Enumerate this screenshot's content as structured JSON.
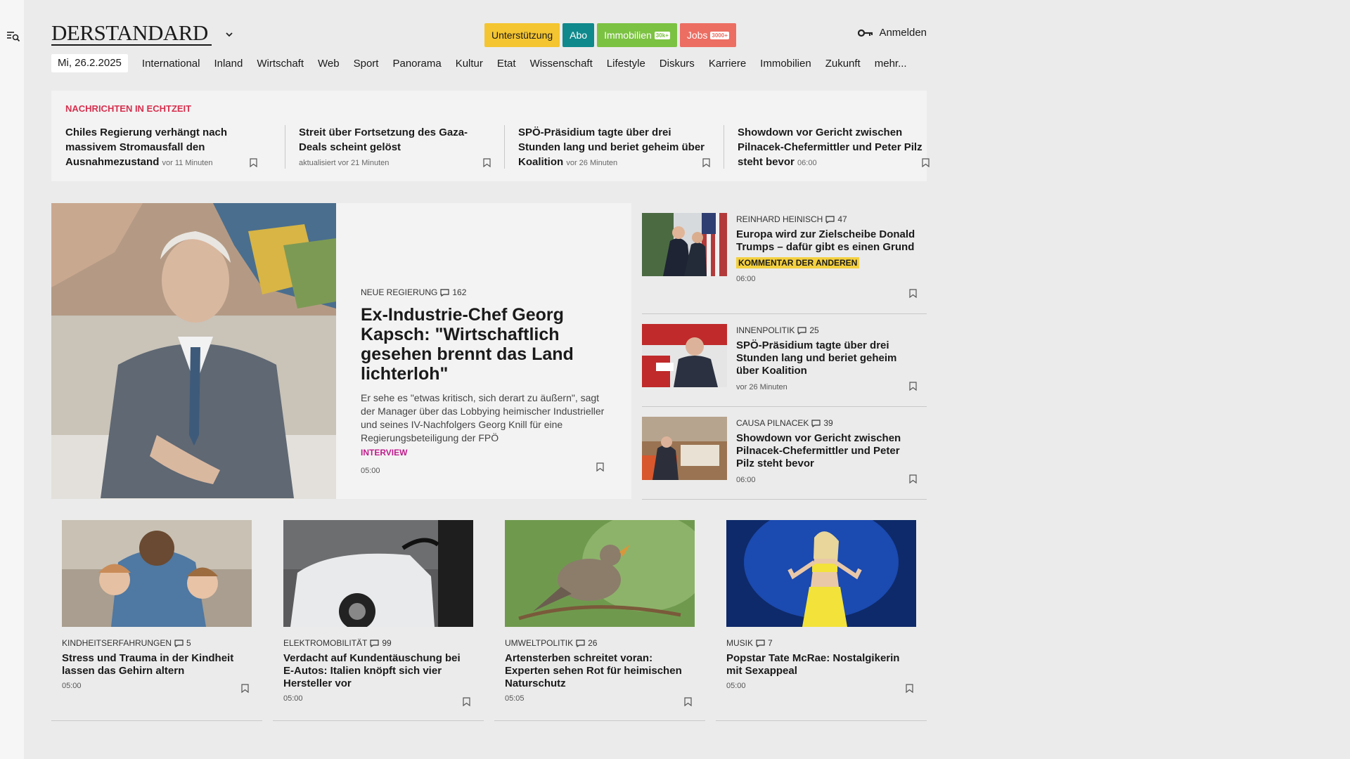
{
  "rail": {
    "icon": "search-menu-icon"
  },
  "header": {
    "logo": "DERSTANDARD",
    "buttons": [
      {
        "label": "Unterstützung"
      },
      {
        "label": "Abo"
      },
      {
        "label": "Immobilien",
        "tag": "30k+"
      },
      {
        "label": "Jobs",
        "tag": "3000+"
      }
    ],
    "login": "Anmelden"
  },
  "nav": {
    "date": "Mi, 26.2.2025",
    "items": [
      "International",
      "Inland",
      "Wirtschaft",
      "Web",
      "Sport",
      "Panorama",
      "Kultur",
      "Etat",
      "Wissenschaft",
      "Lifestyle",
      "Diskurs",
      "Karriere",
      "Immobilien",
      "Zukunft",
      "mehr..."
    ]
  },
  "realtime": {
    "title": "NACHRICHTEN IN ECHTZEIT",
    "items": [
      {
        "title": "Chiles Regierung verhängt nach massivem Stromausfall den Ausnahmezustand",
        "time": "vor 11 Minuten"
      },
      {
        "title": "Streit über Fortsetzung des Gaza-Deals scheint gelöst",
        "time": "aktualisiert vor 21 Minuten"
      },
      {
        "title": "SPÖ-Präsidium tagte über drei Stunden lang und beriet geheim über Koalition",
        "time": "vor 26 Minuten"
      },
      {
        "title": "Showdown vor Gericht zwischen Pilnacek-Chefermittler und Peter Pilz steht bevor",
        "time": "06:00"
      }
    ]
  },
  "lead": {
    "kicker": "NEUE REGIERUNG",
    "comments": "162",
    "title": "Ex-Industrie-Chef Georg Kapsch: \"Wirtschaftlich gesehen brennt das Land lichterloh\"",
    "teaser": "Er sehe es \"etwas kritisch, sich derart zu äußern\", sagt der Manager über das Lobbying heimischer Industrieller und seines IV-Nachfolgers Georg Knill für eine Regierungsbeteiligung der FPÖ",
    "label": "INTERVIEW",
    "time": "05:00"
  },
  "side": [
    {
      "kicker": "REINHARD HEINISCH",
      "comments": "47",
      "title": "Europa wird zur Zielscheibe Donald Trumps – dafür gibt es einen Grund",
      "badge": "KOMMENTAR DER ANDEREN",
      "time": "06:00"
    },
    {
      "kicker": "INNENPOLITIK",
      "comments": "25",
      "title": "SPÖ-Präsidium tagte über drei Stunden lang und beriet geheim über Koalition",
      "time": "vor 26 Minuten"
    },
    {
      "kicker": "CAUSA PILNACEK",
      "comments": "39",
      "title": "Showdown vor Gericht zwischen Pilnacek-Chefermittler und Peter Pilz steht bevor",
      "time": "06:00"
    }
  ],
  "cards": [
    {
      "kicker": "KINDHEITSERFAHRUNGEN",
      "comments": "5",
      "title": "Stress und Trauma in der Kindheit lassen das Gehirn altern",
      "time": "05:00"
    },
    {
      "kicker": "ELEKTROMOBILITÄT",
      "comments": "99",
      "title": "Verdacht auf Kundentäuschung bei E-Autos: Italien knöpft sich vier Hersteller vor",
      "time": "05:00"
    },
    {
      "kicker": "UMWELTPOLITIK",
      "comments": "26",
      "title": "Artensterben schreitet voran: Experten sehen Rot für heimischen Naturschutz",
      "time": "05:05"
    },
    {
      "kicker": "MUSIK",
      "comments": "7",
      "title": "Popstar Tate McRae: Nostalgikerin mit Sexappeal",
      "time": "05:00"
    }
  ]
}
